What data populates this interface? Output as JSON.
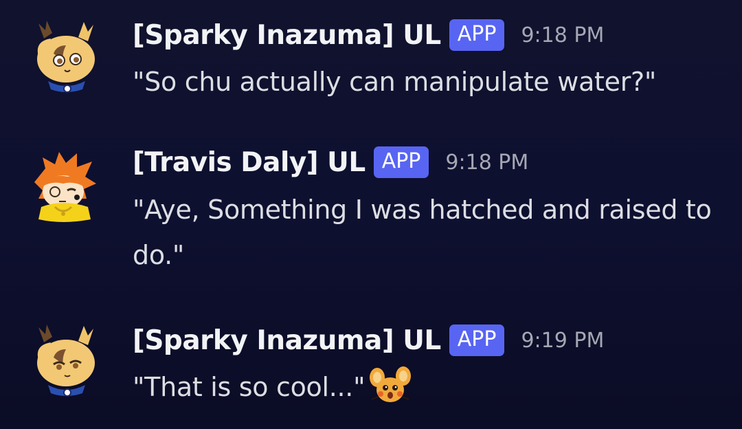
{
  "messages": [
    {
      "author": "[Sparky Inazuma] UL",
      "badge": "APP",
      "time": "9:18 PM",
      "text": "\"So chu actually can manipulate water?\"",
      "avatar": "brown-antlered-fox-avatar"
    },
    {
      "author": "[Travis Daly] UL",
      "badge": "APP",
      "time": "9:18 PM",
      "text": "\"Aye, Something I was hatched and raised to do.\"",
      "avatar": "orange-haired-yellow-hoodie-avatar"
    },
    {
      "author": "[Sparky Inazuma] UL",
      "badge": "APP",
      "time": "9:19 PM",
      "text": "\"That is so cool...\"",
      "avatar": "brown-antlered-fox-avatar",
      "emoji": "dedenne-surprised-emoji"
    }
  ],
  "colors": {
    "background": "#10122e",
    "badge": "#5865f2",
    "username": "#f2f3f5",
    "timestamp": "#a5a7b3",
    "text": "#dcdee3"
  }
}
